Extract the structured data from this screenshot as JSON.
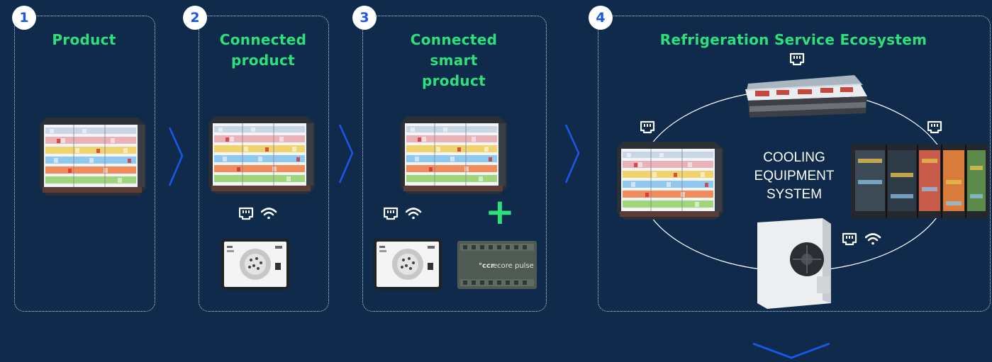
{
  "stages": [
    {
      "number": "1",
      "title": "Product"
    },
    {
      "number": "2",
      "title": "Connected\nproduct"
    },
    {
      "number": "3",
      "title": "Connected\nsmart\nproduct"
    },
    {
      "number": "4",
      "title": "Refrigeration Service Ecosystem"
    }
  ],
  "ecosystem": {
    "center_line1": "COOLING",
    "center_line2": "EQUIPMENT",
    "center_line3": "SYSTEM"
  },
  "controller": {
    "brand": "°ccr",
    "label": "ecore pulse"
  },
  "colors": {
    "background": "#0f2a4a",
    "accent_green": "#2ee07a",
    "accent_blue": "#1a56e8",
    "chevron": "#1a56e8"
  },
  "icons": [
    "ethernet-icon",
    "wifi-icon",
    "plus-icon",
    "chevron-right-icon",
    "chevron-down-icon"
  ]
}
